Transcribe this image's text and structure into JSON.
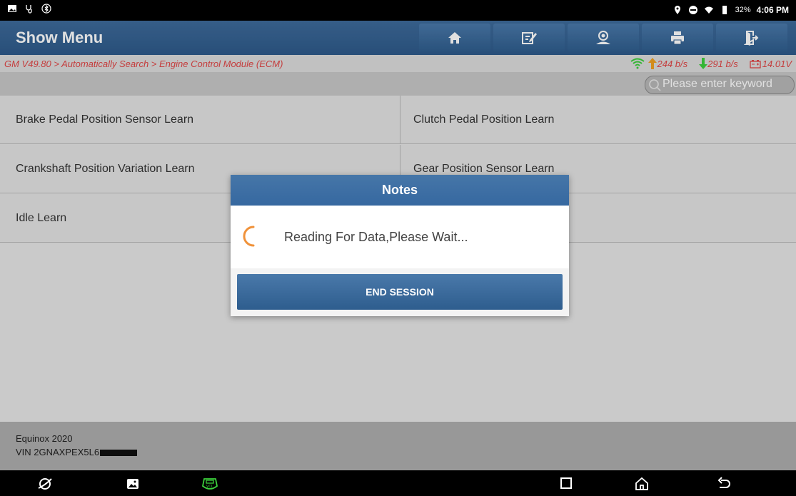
{
  "status_bar": {
    "battery": "32%",
    "time": "4:06 PM"
  },
  "header": {
    "title": "Show Menu",
    "tools": [
      {
        "icon": "home-icon"
      },
      {
        "icon": "edit-report-icon"
      },
      {
        "icon": "user-icon"
      },
      {
        "icon": "print-icon"
      },
      {
        "icon": "exit-icon"
      }
    ]
  },
  "breadcrumb": "GM V49.80 > Automatically Search > Engine Control Module (ECM)",
  "metrics": {
    "upload": "244 b/s",
    "download": "291 b/s",
    "voltage": "14.01V"
  },
  "search": {
    "placeholder": "Please enter keyword"
  },
  "menu_items": [
    "Brake Pedal Position Sensor Learn",
    "Clutch Pedal Position Learn",
    "Crankshaft Position Variation Learn",
    "Gear Position Sensor Learn",
    "Idle Learn",
    ""
  ],
  "vehicle": {
    "model": "Equinox 2020",
    "vin": "VIN 2GNAXPEX5L6"
  },
  "dialog": {
    "title": "Notes",
    "message": "Reading For Data,Please Wait...",
    "button": "END SESSION"
  },
  "colors": {
    "accent": "#3668a0",
    "breadcrumb": "#e04646",
    "spinner": "#f0923a",
    "signal": "#3ccf3c"
  }
}
